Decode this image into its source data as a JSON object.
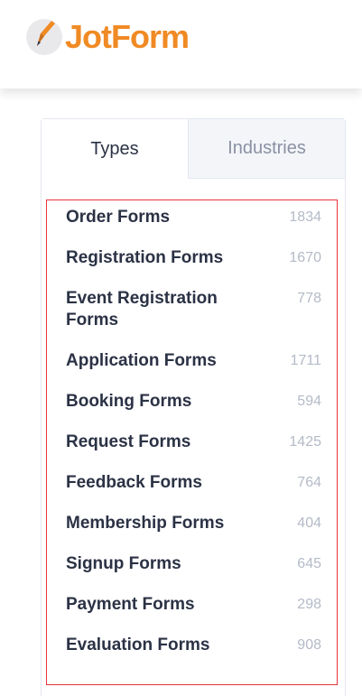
{
  "brand": {
    "name": "JotForm",
    "accent": "#f08a24"
  },
  "tabs": [
    {
      "label": "Types",
      "active": true
    },
    {
      "label": "Industries",
      "active": false
    }
  ],
  "form_types": [
    {
      "name": "Order Forms",
      "count": "1834"
    },
    {
      "name": "Registration Forms",
      "count": "1670"
    },
    {
      "name": "Event Registration Forms",
      "count": "778"
    },
    {
      "name": "Application Forms",
      "count": "1711"
    },
    {
      "name": "Booking Forms",
      "count": "594"
    },
    {
      "name": "Request Forms",
      "count": "1425"
    },
    {
      "name": "Feedback Forms",
      "count": "764"
    },
    {
      "name": "Membership Forms",
      "count": "404"
    },
    {
      "name": "Signup Forms",
      "count": "645"
    },
    {
      "name": "Payment Forms",
      "count": "298"
    },
    {
      "name": "Evaluation Forms",
      "count": "908"
    }
  ]
}
